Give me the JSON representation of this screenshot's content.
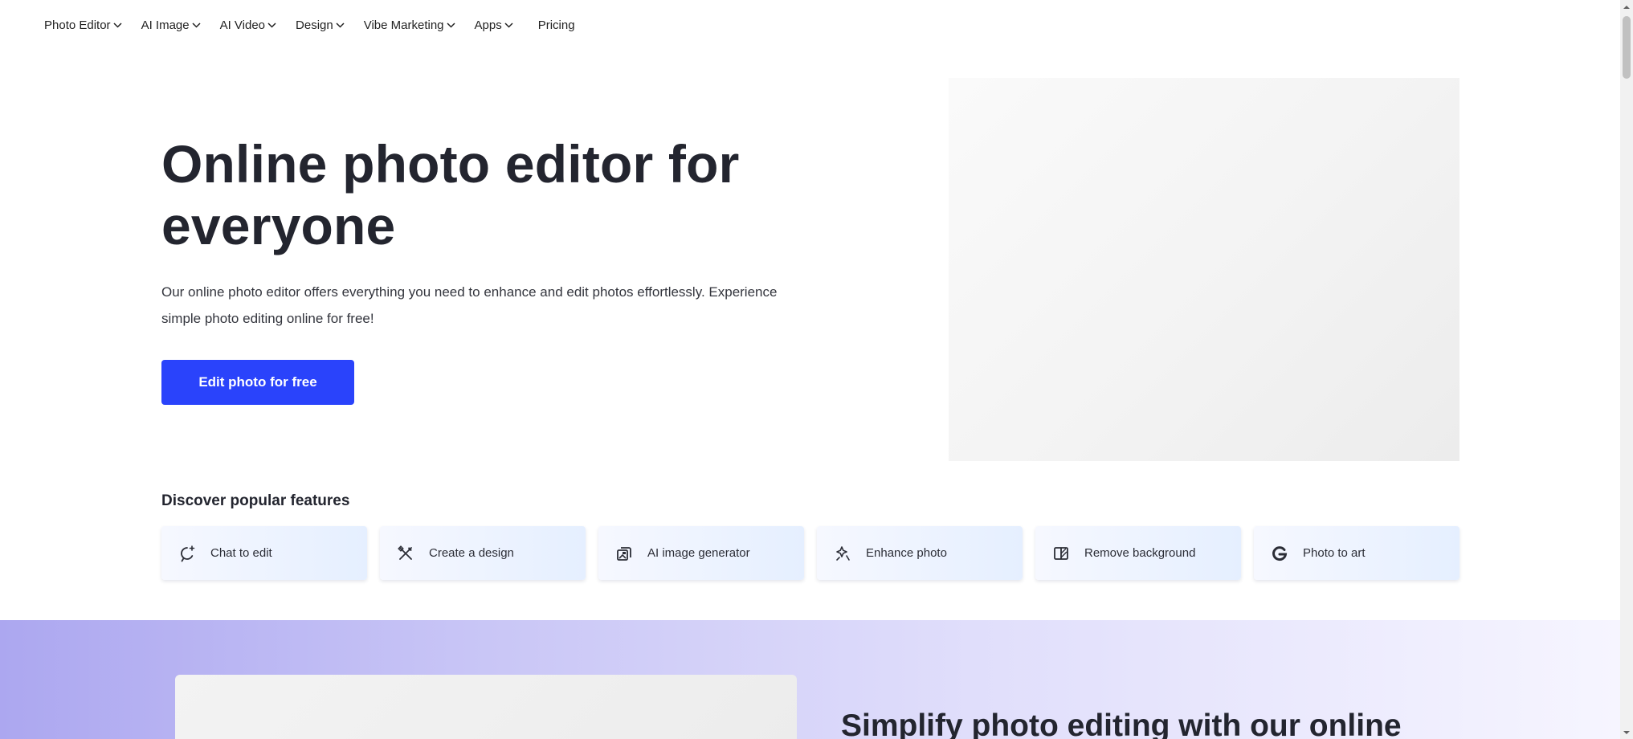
{
  "nav": {
    "items": [
      {
        "label": "Photo Editor",
        "has_dropdown": true
      },
      {
        "label": "AI Image",
        "has_dropdown": true
      },
      {
        "label": "AI Video",
        "has_dropdown": true
      },
      {
        "label": "Design",
        "has_dropdown": true
      },
      {
        "label": "Vibe Marketing",
        "has_dropdown": true
      },
      {
        "label": "Apps",
        "has_dropdown": true
      }
    ],
    "pricing_label": "Pricing"
  },
  "hero": {
    "title": "Online photo editor for everyone",
    "description": "Our online photo editor offers everything you need to enhance and edit photos effortlessly. Experience simple photo editing online for free!",
    "cta_label": "Edit photo for free"
  },
  "features": {
    "title": "Discover popular features",
    "items": [
      {
        "label": "Chat to edit",
        "icon": "chat-sparkle-icon"
      },
      {
        "label": "Create a design",
        "icon": "design-tools-icon"
      },
      {
        "label": "AI image generator",
        "icon": "image-generator-icon"
      },
      {
        "label": "Enhance photo",
        "icon": "enhance-sparkle-icon"
      },
      {
        "label": "Remove background",
        "icon": "remove-background-icon"
      },
      {
        "label": "Photo to art",
        "icon": "photo-to-art-icon"
      }
    ]
  },
  "section2": {
    "title": "Simplify photo editing with our online"
  },
  "colors": {
    "accent": "#2a43fb",
    "text": "#23252f",
    "band_start": "#aca7f0",
    "band_end": "#f6f5ff"
  }
}
